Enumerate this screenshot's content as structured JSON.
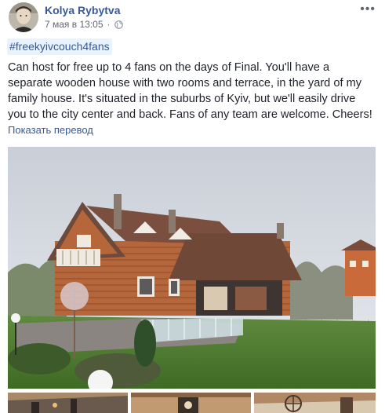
{
  "post": {
    "author": "Kolya Rybytva",
    "date": "7 мая в 13:05",
    "separator": "·",
    "hashtag": "#freekyivcouch4fans",
    "body": "Can host for free up to 4 fans on the days of Final. You'll have a separate wooden house with two rooms and terrace, in the yard of my family house. It's situated in the suburbs of Kyiv, but we'll easily drive you to the city center and back. Fans of any team are welcome. Cheers!",
    "translate_label": "Показать перевод"
  },
  "icons": {
    "privacy": "globe-icon",
    "options": "more-icon"
  },
  "colors": {
    "link": "#385898",
    "hashtag_bg": "#e7f3ff",
    "text": "#1d2129",
    "meta": "#616770"
  }
}
